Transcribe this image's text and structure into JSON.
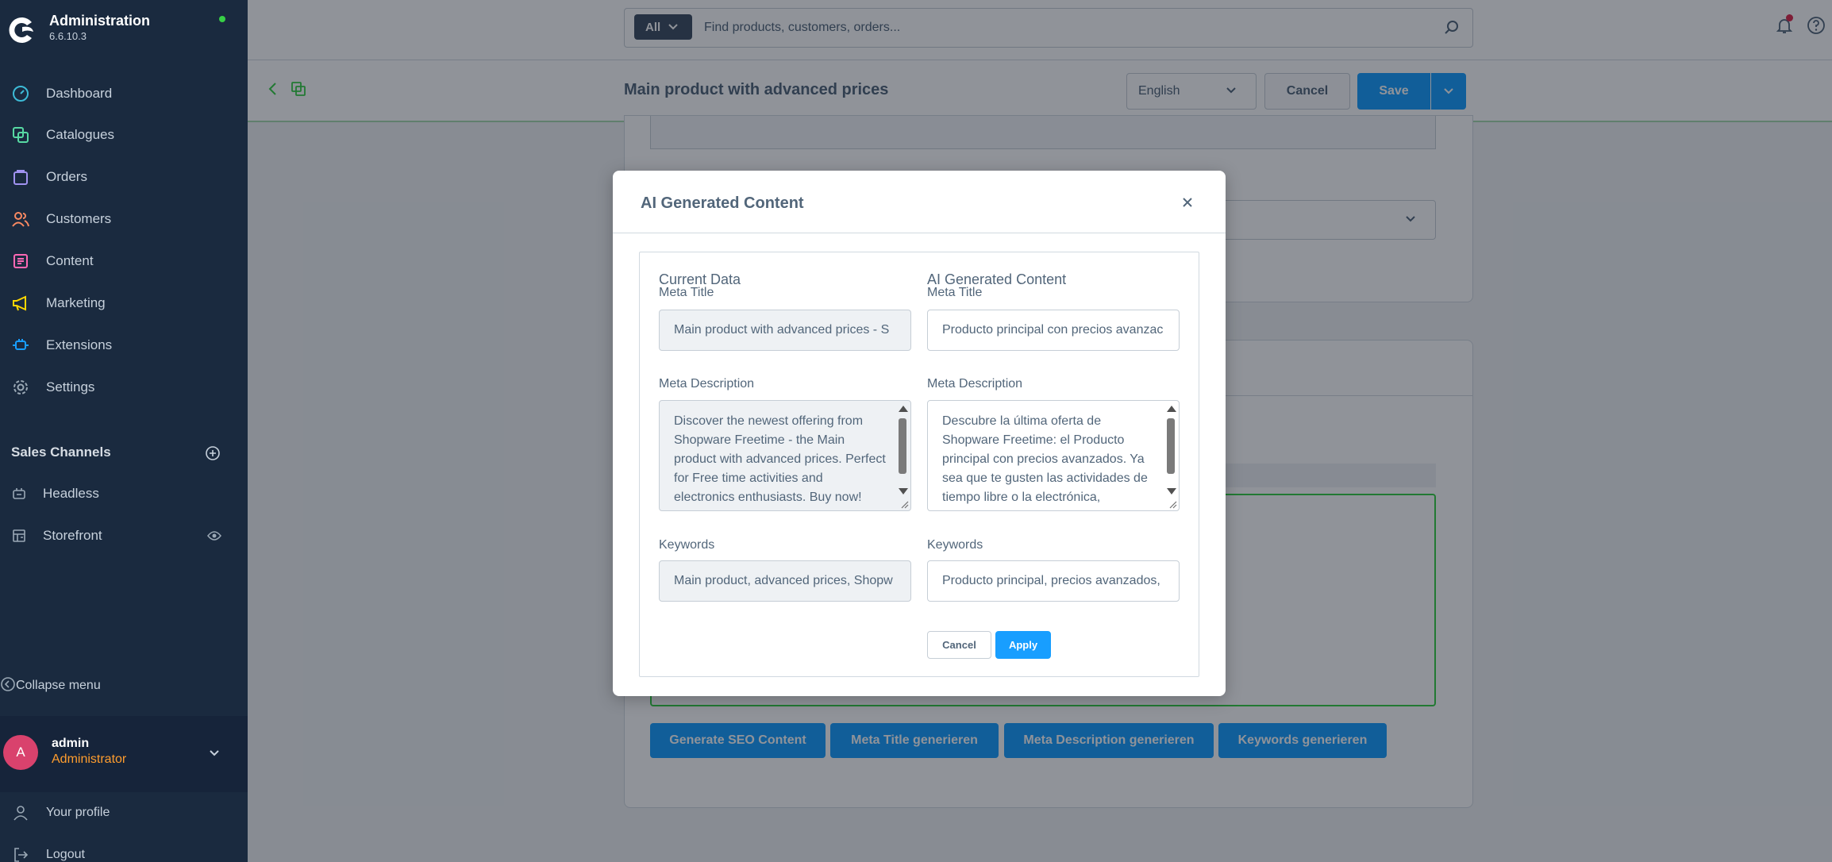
{
  "brand": {
    "title": "Administration",
    "version": "6.6.10.3"
  },
  "sidebar": {
    "items": [
      {
        "label": "Dashboard",
        "icon": "dashboard-icon",
        "color": "#3dbbd7"
      },
      {
        "label": "Catalogues",
        "icon": "catalogues-icon",
        "color": "#57d9a3"
      },
      {
        "label": "Orders",
        "icon": "orders-icon",
        "color": "#a092f0"
      },
      {
        "label": "Customers",
        "icon": "customers-icon",
        "color": "#f88962"
      },
      {
        "label": "Content",
        "icon": "content-icon",
        "color": "#ff68b4"
      },
      {
        "label": "Marketing",
        "icon": "marketing-icon",
        "color": "#ffd700"
      },
      {
        "label": "Extensions",
        "icon": "extensions-icon",
        "color": "#189eff"
      },
      {
        "label": "Settings",
        "icon": "settings-icon",
        "color": "#9aa8b5"
      }
    ],
    "sales_channels_heading": "Sales Channels",
    "sales_channels": [
      {
        "label": "Headless",
        "icon": "headless-icon"
      },
      {
        "label": "Storefront",
        "icon": "storefront-icon"
      }
    ],
    "collapse_label": "Collapse menu",
    "user": {
      "initial": "A",
      "name": "admin",
      "role": "Administrator"
    },
    "profile_label": "Your profile",
    "logout_label": "Logout"
  },
  "search": {
    "scope": "All",
    "placeholder": "Find products, customers, orders..."
  },
  "smartbar": {
    "title": "Main product with advanced prices",
    "language": "English",
    "cancel_label": "Cancel",
    "save_label": "Save"
  },
  "background_buttons": [
    "Generate SEO Content",
    "Meta Title generieren",
    "Meta Description generieren",
    "Keywords generieren"
  ],
  "modal": {
    "title": "AI Generated Content",
    "current": {
      "heading": "Current Data",
      "meta_title_label": "Meta Title",
      "meta_title": "Main product with advanced prices - S",
      "meta_description_label": "Meta Description",
      "meta_description": "Discover the newest offering from Shopware Freetime - the Main product with advanced prices. Perfect for Free time activities and electronics enthusiasts. Buy now!",
      "keywords_label": "Keywords",
      "keywords": "Main product, advanced prices, Shopw"
    },
    "ai": {
      "heading": "AI Generated Content",
      "meta_title_label": "Meta Title",
      "meta_title": "Producto principal con precios avanzac",
      "meta_description_label": "Meta Description",
      "meta_description": "Descubre la última oferta de Shopware Freetime: el Producto principal con precios avanzados. Ya sea que te gusten las actividades de tiempo libre o la electrónica,",
      "keywords_label": "Keywords",
      "keywords": "Producto principal, precios avanzados,"
    },
    "cancel_label": "Cancel",
    "apply_label": "Apply"
  },
  "colors": {
    "accent": "#189eff",
    "sidebar_bg": "#1a2a3f",
    "success": "#37d046"
  }
}
